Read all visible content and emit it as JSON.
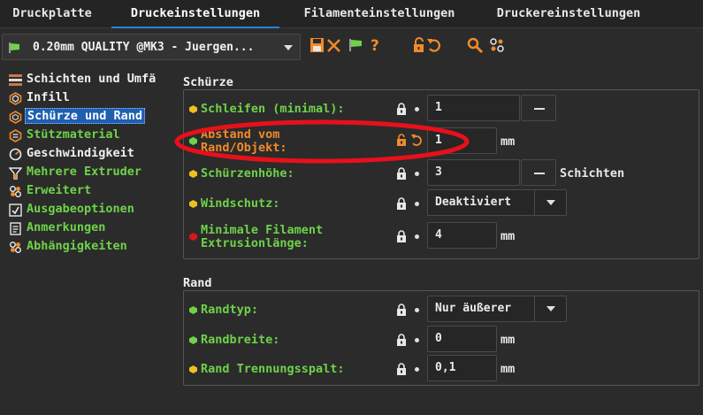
{
  "tabs": [
    {
      "label": "Druckplatte"
    },
    {
      "label": "Druckeinstellungen"
    },
    {
      "label": "Filamenteinstellungen"
    },
    {
      "label": "Druckereinstellungen"
    }
  ],
  "toolbar": {
    "preset_value": "0.20mm QUALITY @MK3 - Juergen...",
    "icons": [
      "flag-icon",
      "save-icon",
      "delete-icon",
      "compare-flag-icon",
      "help-icon",
      "lock-icon",
      "undo-icon",
      "search-icon",
      "mode-icon"
    ]
  },
  "sidebar": {
    "items": [
      {
        "label": "Schichten und Umfä",
        "icon": "layers-icon",
        "color": "white"
      },
      {
        "label": "Infill",
        "icon": "infill-icon",
        "color": "white"
      },
      {
        "label": "Schürze und Rand",
        "icon": "skirt-icon",
        "color": "white",
        "selected": true
      },
      {
        "label": "Stützmaterial",
        "icon": "support-icon",
        "color": "green"
      },
      {
        "label": "Geschwindigkeit",
        "icon": "speed-icon",
        "color": "white"
      },
      {
        "label": "Mehrere Extruder",
        "icon": "extruder-icon",
        "color": "green"
      },
      {
        "label": "Erweitert",
        "icon": "advanced-icon",
        "color": "green"
      },
      {
        "label": "Ausgabeoptionen",
        "icon": "output-icon",
        "color": "green"
      },
      {
        "label": "Anmerkungen",
        "icon": "notes-icon",
        "color": "green"
      },
      {
        "label": "Abhängigkeiten",
        "icon": "dependencies-icon",
        "color": "green"
      }
    ]
  },
  "skirt": {
    "title": "Schürze",
    "loops_label": "Schleifen (minimal):",
    "loops_value": "1",
    "distance_label_1": "Abstand vom",
    "distance_label_2": "Rand/Objekt:",
    "distance_value": "1",
    "distance_unit": "mm",
    "height_label": "Schürzenhöhe:",
    "height_value": "3",
    "height_unit": "Schichten",
    "draft_label": "Windschutz:",
    "draft_value": "Deaktiviert",
    "min_label_1": "Minimale Filament",
    "min_label_2": "Extrusionlänge:",
    "min_value": "4",
    "min_unit": "mm"
  },
  "brim": {
    "title": "Rand",
    "type_label": "Randtyp:",
    "type_value": "Nur äußerer",
    "width_label": "Randbreite:",
    "width_value": "0",
    "width_unit": "mm",
    "gap_label": "Rand Trennungsspalt:",
    "gap_value": "0,1",
    "gap_unit": "mm"
  },
  "colors": {
    "accent": "#2f7fd8",
    "green": "#6fd24a",
    "orange": "#f08a2b",
    "yellow_bullet": "#f0c020",
    "red_bullet": "#d81818",
    "annotation_red": "#e8101a"
  }
}
